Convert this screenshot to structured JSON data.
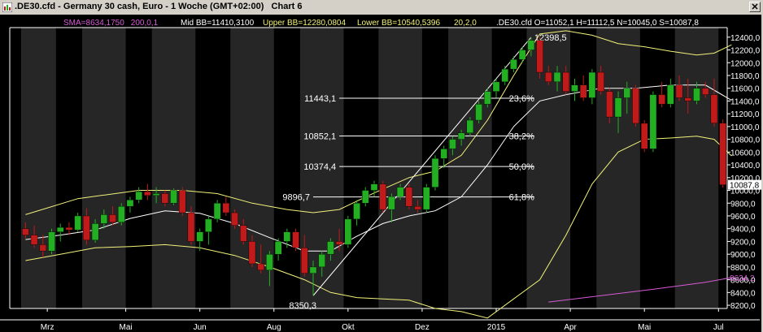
{
  "window": {
    "title": ".DE30.cfd - Germany 30 cash, Euro - 1 Woche (GMT+02:00)",
    "chart_name": "Chart 6"
  },
  "colors": {
    "background": "#000000",
    "up_candle": "#22b022",
    "down_candle": "#c01a1a",
    "bollinger": "#f2f27a",
    "sma": "#d65cd6",
    "fib_line": "#ffffff",
    "text": "#ffffff",
    "stripe": "#262626"
  },
  "indicators": {
    "sma_label": "SMA=8634,1750",
    "sma_params": "200,0,1",
    "mid_bb": "Mid BB=11410,3100",
    "upper_bb": "Upper BB=12280,0804",
    "lower_bb": "Lower BB=10540,5396",
    "bb_params": "20,2,0",
    "ohlc": ".DE30.cfd O=11052,1 H=11112,5 N=10045,0 S=10087,8"
  },
  "chart_data": {
    "type": "candlestick",
    "title": ".DE30.cfd - Germany 30 cash, Euro - 1 Woche (GMT+02:00)",
    "ylim": [
      8150,
      12550
    ],
    "yticks": [
      8200,
      8400,
      8600,
      8800,
      9000,
      9200,
      9400,
      9600,
      9800,
      10000,
      10200,
      10400,
      10600,
      10800,
      11000,
      11200,
      11400,
      11600,
      11800,
      12000,
      12200,
      12400
    ],
    "ytick_labels": [
      "8200,0",
      "8400,0",
      "8600,0",
      "8800,0",
      "9000,0",
      "9200,0",
      "9400,0",
      "9600,0",
      "9800,0",
      "10000,0",
      "10200,0",
      "10400,0",
      "10600,0",
      "10800,0",
      "11000,0",
      "11200,0",
      "11400,0",
      "11600,0",
      "11800,0",
      "12000,0",
      "12200,0",
      "12400,0"
    ],
    "current_price_label": "10087,8",
    "sma_label_axis": "8634,2",
    "xaxis_labels": [
      {
        "label": "Mrz",
        "bar": 2.5
      },
      {
        "label": "Mai",
        "bar": 11.5
      },
      {
        "label": "Jun",
        "bar": 20
      },
      {
        "label": "Aug",
        "bar": 28.5
      },
      {
        "label": "Okt",
        "bar": 37
      },
      {
        "label": "Dez",
        "bar": 45.5
      },
      {
        "label": "2015",
        "bar": 54
      },
      {
        "label": "Apr",
        "bar": 62.5
      },
      {
        "label": "Mai",
        "bar": 71
      },
      {
        "label": "Jul",
        "bar": 79.5
      }
    ],
    "stripes": [
      [
        0,
        3
      ],
      [
        7,
        11
      ],
      [
        15,
        19
      ],
      [
        24,
        28
      ],
      [
        32,
        36
      ],
      [
        41,
        45
      ],
      [
        49,
        53
      ],
      [
        58,
        62
      ],
      [
        66,
        70
      ],
      [
        75,
        79
      ]
    ],
    "bars": [
      [
        9400,
        9500,
        9250,
        9300
      ],
      [
        9300,
        9450,
        9100,
        9150
      ],
      [
        9150,
        9300,
        8950,
        9050
      ],
      [
        9050,
        9400,
        9000,
        9350
      ],
      [
        9350,
        9480,
        9200,
        9420
      ],
      [
        9420,
        9500,
        9300,
        9380
      ],
      [
        9380,
        9650,
        9350,
        9600
      ],
      [
        9600,
        9720,
        9150,
        9220
      ],
      [
        9220,
        9550,
        9180,
        9480
      ],
      [
        9480,
        9700,
        9400,
        9620
      ],
      [
        9620,
        9750,
        9450,
        9500
      ],
      [
        9500,
        9800,
        9450,
        9750
      ],
      [
        9750,
        9900,
        9650,
        9850
      ],
      [
        9850,
        10050,
        9800,
        9980
      ],
      [
        9980,
        10100,
        9850,
        9920
      ],
      [
        9920,
        10050,
        9800,
        9950
      ],
      [
        9950,
        10000,
        9750,
        9800
      ],
      [
        9800,
        10030,
        9770,
        10000
      ],
      [
        10000,
        10050,
        9600,
        9650
      ],
      [
        9650,
        9750,
        9150,
        9200
      ],
      [
        9200,
        9400,
        9050,
        9350
      ],
      [
        9350,
        9600,
        9150,
        9550
      ],
      [
        9550,
        9850,
        9500,
        9800
      ],
      [
        9800,
        9900,
        9600,
        9650
      ],
      [
        9650,
        9700,
        9400,
        9450
      ],
      [
        9450,
        9550,
        9150,
        9200
      ],
      [
        9200,
        9300,
        8800,
        8850
      ],
      [
        8850,
        9150,
        8700,
        8750
      ],
      [
        8750,
        9050,
        8500,
        9000
      ],
      [
        9000,
        9250,
        8900,
        9200
      ],
      [
        9200,
        9400,
        9100,
        9350
      ],
      [
        9350,
        9400,
        9050,
        9100
      ],
      [
        9100,
        9300,
        8650,
        8700
      ],
      [
        8700,
        8900,
        8350,
        8800
      ],
      [
        8800,
        9050,
        8650,
        9000
      ],
      [
        9000,
        9250,
        8900,
        9200
      ],
      [
        9200,
        9400,
        9050,
        9150
      ],
      [
        9150,
        9600,
        9100,
        9550
      ],
      [
        9550,
        9850,
        9450,
        9800
      ],
      [
        9800,
        10050,
        9750,
        10000
      ],
      [
        10000,
        10150,
        9900,
        10100
      ],
      [
        10100,
        10150,
        9650,
        9700
      ],
      [
        9700,
        9950,
        9500,
        9900
      ],
      [
        9900,
        10100,
        9850,
        10050
      ],
      [
        10050,
        10100,
        9700,
        9750
      ],
      [
        9750,
        9850,
        9650,
        9700
      ],
      [
        9700,
        10100,
        9650,
        10050
      ],
      [
        10050,
        10550,
        10000,
        10500
      ],
      [
        10500,
        10700,
        10350,
        10650
      ],
      [
        10650,
        10850,
        10550,
        10800
      ],
      [
        10800,
        10950,
        10700,
        10900
      ],
      [
        10900,
        11150,
        10850,
        11100
      ],
      [
        11100,
        11400,
        11050,
        11350
      ],
      [
        11350,
        11600,
        11300,
        11550
      ],
      [
        11550,
        11750,
        11450,
        11700
      ],
      [
        11700,
        11950,
        11650,
        11900
      ],
      [
        11900,
        12100,
        11850,
        12050
      ],
      [
        12050,
        12250,
        12000,
        12200
      ],
      [
        12200,
        12398,
        12100,
        12350
      ],
      [
        12350,
        12400,
        11750,
        11850
      ],
      [
        11850,
        11950,
        11650,
        11700
      ],
      [
        11700,
        11950,
        11550,
        11850
      ],
      [
        11850,
        11950,
        11500,
        11550
      ],
      [
        11550,
        11750,
        11400,
        11650
      ],
      [
        11650,
        11800,
        11400,
        11450
      ],
      [
        11450,
        11900,
        11350,
        11850
      ],
      [
        11850,
        11950,
        11500,
        11550
      ],
      [
        11550,
        11600,
        11050,
        11150
      ],
      [
        11150,
        11550,
        10900,
        11450
      ],
      [
        11450,
        11700,
        11200,
        11600
      ],
      [
        11600,
        11650,
        11000,
        11050
      ],
      [
        11050,
        11100,
        10600,
        10650
      ],
      [
        10650,
        11550,
        10600,
        11500
      ],
      [
        11500,
        11700,
        11300,
        11350
      ],
      [
        11350,
        11750,
        11300,
        11650
      ],
      [
        11650,
        11800,
        11400,
        11450
      ],
      [
        11450,
        11750,
        11200,
        11400
      ],
      [
        11400,
        11700,
        11350,
        11600
      ],
      [
        11600,
        11700,
        11450,
        11500
      ],
      [
        11500,
        11750,
        11000,
        11052
      ],
      [
        11052,
        11112.5,
        10045,
        10087.8
      ]
    ],
    "bollinger": {
      "upper": [
        [
          0,
          9620
        ],
        [
          6,
          9870
        ],
        [
          13,
          10000
        ],
        [
          18,
          10000
        ],
        [
          22,
          9950
        ],
        [
          26,
          9800
        ],
        [
          30,
          9700
        ],
        [
          33,
          9650
        ],
        [
          36,
          9700
        ],
        [
          40,
          9960
        ],
        [
          44,
          10200
        ],
        [
          47,
          10300
        ],
        [
          50,
          10550
        ],
        [
          53,
          11100
        ],
        [
          56,
          11800
        ],
        [
          59,
          12450
        ],
        [
          62,
          12500
        ],
        [
          65,
          12430
        ],
        [
          68,
          12300
        ],
        [
          71,
          12250
        ],
        [
          74,
          12180
        ],
        [
          77,
          12120
        ],
        [
          79,
          12150
        ],
        [
          81,
          12280
        ]
      ],
      "middle": [
        [
          0,
          9230
        ],
        [
          4,
          9300
        ],
        [
          8,
          9380
        ],
        [
          12,
          9560
        ],
        [
          16,
          9680
        ],
        [
          20,
          9640
        ],
        [
          24,
          9480
        ],
        [
          28,
          9260
        ],
        [
          32,
          9050
        ],
        [
          35,
          9050
        ],
        [
          38,
          9280
        ],
        [
          41,
          9480
        ],
        [
          44,
          9600
        ],
        [
          47,
          9680
        ],
        [
          50,
          9900
        ],
        [
          53,
          10400
        ],
        [
          56,
          11000
        ],
        [
          59,
          11400
        ],
        [
          62,
          11500
        ],
        [
          66,
          11600
        ],
        [
          70,
          11600
        ],
        [
          74,
          11650
        ],
        [
          78,
          11650
        ],
        [
          81,
          11410
        ]
      ],
      "lower": [
        [
          0,
          8900
        ],
        [
          4,
          9000
        ],
        [
          8,
          9100
        ],
        [
          12,
          9120
        ],
        [
          16,
          9150
        ],
        [
          20,
          9100
        ],
        [
          24,
          8980
        ],
        [
          28,
          8800
        ],
        [
          32,
          8600
        ],
        [
          35,
          8400
        ],
        [
          38,
          8320
        ],
        [
          41,
          8300
        ],
        [
          44,
          8280
        ],
        [
          47,
          8150
        ],
        [
          50,
          8100
        ],
        [
          53,
          8000
        ],
        [
          56,
          8300
        ],
        [
          59,
          8600
        ],
        [
          62,
          9300
        ],
        [
          65,
          10100
        ],
        [
          68,
          10600
        ],
        [
          71,
          10800
        ],
        [
          74,
          10820
        ],
        [
          77,
          10850
        ],
        [
          79,
          10800
        ],
        [
          81,
          10540
        ]
      ]
    },
    "sma": [
      [
        60,
        8250
      ],
      [
        66,
        8350
      ],
      [
        72,
        8450
      ],
      [
        78,
        8560
      ],
      [
        81,
        8634
      ]
    ],
    "fibonacci": {
      "swing_low": {
        "bar": 33,
        "price": 8350.3,
        "label": "8350,3"
      },
      "swing_high": {
        "bar": 58,
        "price": 12398.5,
        "label": "12398,5"
      },
      "levels": [
        {
          "price": 11443.1,
          "price_label": "11443,1",
          "pct": "23,6%",
          "bar_start": 36
        },
        {
          "price": 10852.1,
          "price_label": "10852,1",
          "pct": "38,2%",
          "bar_start": 36
        },
        {
          "price": 10374.4,
          "price_label": "10374,4",
          "pct": "50,0%",
          "bar_start": 36
        },
        {
          "price": 9896.7,
          "price_label": "9896,7",
          "pct": "61,8%",
          "bar_start": 33
        }
      ]
    }
  }
}
